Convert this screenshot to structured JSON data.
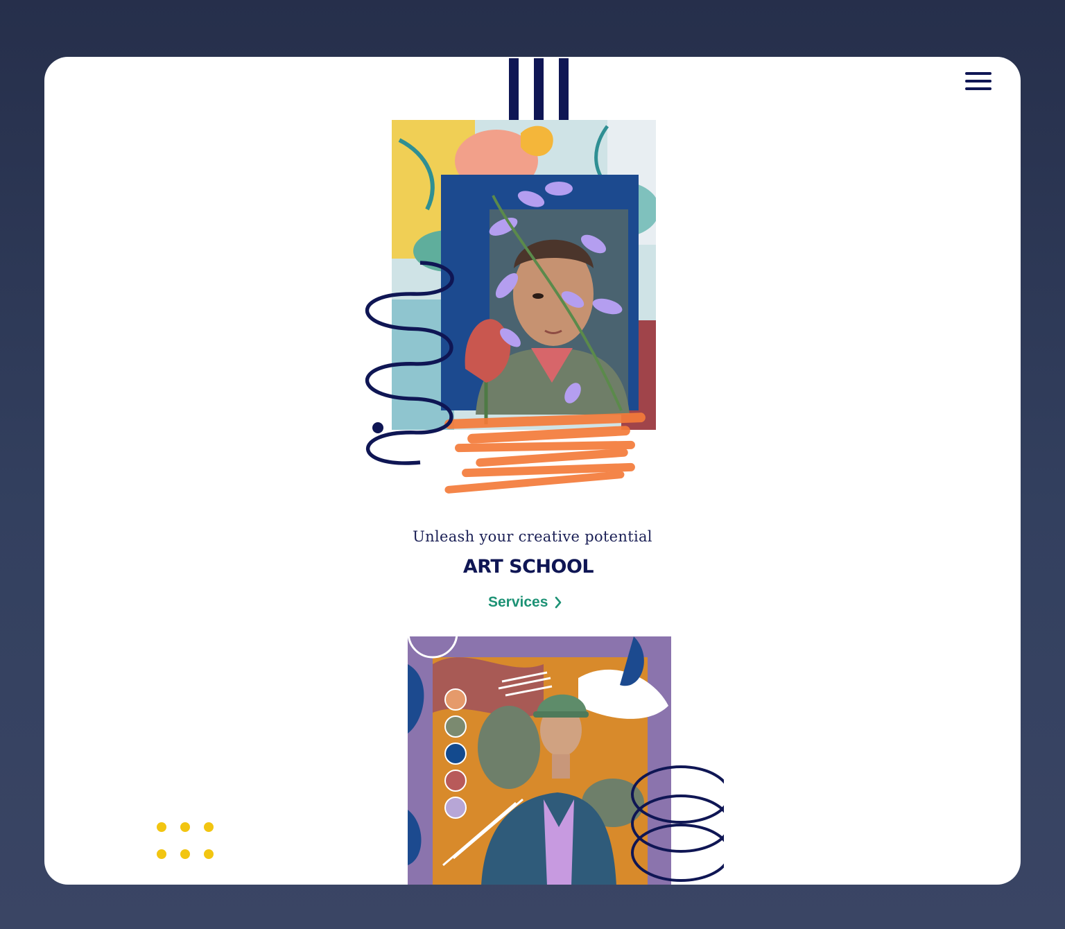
{
  "header": {
    "logo_icon": "three-vertical-bars-logo",
    "menu_icon": "hamburger-menu-icon"
  },
  "hero": {
    "tagline": "Unleash your creative potential",
    "title": "ART SCHOOL",
    "services_label": "Services",
    "services_icon": "chevron-right-icon"
  },
  "colors": {
    "navy": "#0f1654",
    "green_link": "#1d9275",
    "orange": "#f47b3a",
    "yellow_dots": "#f2c511",
    "background": "#2c3654",
    "card": "#ffffff"
  },
  "swatches": [
    "#e59a6b",
    "#7b8a70",
    "#134a8e",
    "#b85a5a",
    "#b7a6d6"
  ]
}
